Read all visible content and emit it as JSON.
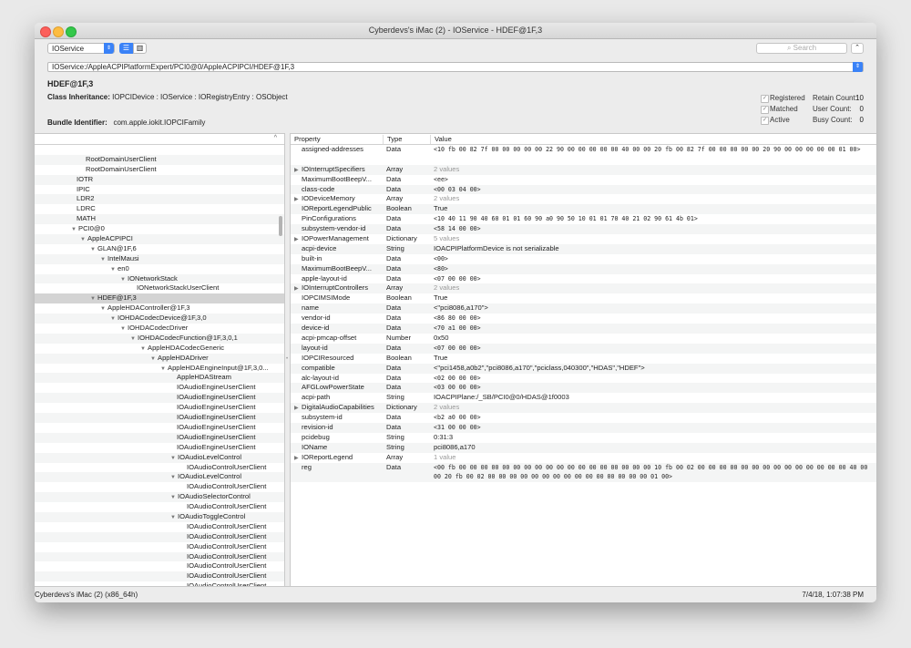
{
  "window": {
    "title": "Cyberdevs's iMac (2) - IOService - HDEF@1F,3"
  },
  "toolbar": {
    "plane": "IOService",
    "search_placeholder": "Search"
  },
  "path": "IOService:/AppleACPIPlatformExpert/PCI0@0/AppleACPIPCI/HDEF@1F,3",
  "info": {
    "entry_name": "HDEF@1F,3",
    "class_inheritance_label": "Class Inheritance:",
    "class_inheritance": "IOPCIDevice : IOService : IORegistryEntry : OSObject",
    "bundle_label": "Bundle Identifier:",
    "bundle_id": "com.apple.iokit.IOPCIFamily",
    "flags": [
      {
        "label": "Registered",
        "count_label": "Retain Count:",
        "count": "10"
      },
      {
        "label": "Matched",
        "count_label": "User Count:",
        "count": "0"
      },
      {
        "label": "Active",
        "count_label": "Busy Count:",
        "count": "0"
      }
    ]
  },
  "tree": [
    {
      "indent": 0,
      "label": "",
      "disclosure": ""
    },
    {
      "indent": 56,
      "label": "RootDomainUserClient",
      "disclosure": ""
    },
    {
      "indent": 56,
      "label": "RootDomainUserClient",
      "disclosure": ""
    },
    {
      "indent": 46,
      "label": "IOTR",
      "disclosure": ""
    },
    {
      "indent": 46,
      "label": "IPIC",
      "disclosure": ""
    },
    {
      "indent": 46,
      "label": "LDR2",
      "disclosure": ""
    },
    {
      "indent": 46,
      "label": "LDRC",
      "disclosure": ""
    },
    {
      "indent": 46,
      "label": "MATH",
      "disclosure": ""
    },
    {
      "indent": 40,
      "label": "PCI0@0",
      "disclosure": "▼"
    },
    {
      "indent": 50,
      "label": "AppleACPIPCI",
      "disclosure": "▼"
    },
    {
      "indent": 61,
      "label": "GLAN@1F,6",
      "disclosure": "▼"
    },
    {
      "indent": 72,
      "label": "IntelMausi",
      "disclosure": "▼"
    },
    {
      "indent": 83,
      "label": "en0",
      "disclosure": "▼"
    },
    {
      "indent": 94,
      "label": "IONetworkStack",
      "disclosure": "▼"
    },
    {
      "indent": 112,
      "label": "IONetworkStackUserClient",
      "disclosure": ""
    },
    {
      "indent": 61,
      "label": "HDEF@1F,3",
      "disclosure": "▼"
    },
    {
      "indent": 72,
      "label": "AppleHDAController@1F,3",
      "disclosure": "▼"
    },
    {
      "indent": 83,
      "label": "IOHDACodecDevice@1F,3,0",
      "disclosure": "▼"
    },
    {
      "indent": 94,
      "label": "IOHDACodecDriver",
      "disclosure": "▼"
    },
    {
      "indent": 105,
      "label": "IOHDACodecFunction@1F,3,0,1",
      "disclosure": "▼"
    },
    {
      "indent": 116,
      "label": "AppleHDACodecGeneric",
      "disclosure": "▼"
    },
    {
      "indent": 127,
      "label": "AppleHDADriver",
      "disclosure": "▼"
    },
    {
      "indent": 138,
      "label": "AppleHDAEngineInput@1F,3,0...",
      "disclosure": "▼"
    },
    {
      "indent": 156,
      "label": "AppleHDAStream",
      "disclosure": ""
    },
    {
      "indent": 156,
      "label": "IOAudioEngineUserClient",
      "disclosure": ""
    },
    {
      "indent": 156,
      "label": "IOAudioEngineUserClient",
      "disclosure": ""
    },
    {
      "indent": 156,
      "label": "IOAudioEngineUserClient",
      "disclosure": ""
    },
    {
      "indent": 156,
      "label": "IOAudioEngineUserClient",
      "disclosure": ""
    },
    {
      "indent": 156,
      "label": "IOAudioEngineUserClient",
      "disclosure": ""
    },
    {
      "indent": 156,
      "label": "IOAudioEngineUserClient",
      "disclosure": ""
    },
    {
      "indent": 156,
      "label": "IOAudioEngineUserClient",
      "disclosure": ""
    },
    {
      "indent": 149,
      "label": "IOAudioLevelControl",
      "disclosure": "▼"
    },
    {
      "indent": 167,
      "label": "IOAudioControlUserClient",
      "disclosure": ""
    },
    {
      "indent": 149,
      "label": "IOAudioLevelControl",
      "disclosure": "▼"
    },
    {
      "indent": 167,
      "label": "IOAudioControlUserClient",
      "disclosure": ""
    },
    {
      "indent": 149,
      "label": "IOAudioSelectorControl",
      "disclosure": "▼"
    },
    {
      "indent": 167,
      "label": "IOAudioControlUserClient",
      "disclosure": ""
    },
    {
      "indent": 149,
      "label": "IOAudioToggleControl",
      "disclosure": "▼"
    },
    {
      "indent": 167,
      "label": "IOAudioControlUserClient",
      "disclosure": ""
    },
    {
      "indent": 167,
      "label": "IOAudioControlUserClient",
      "disclosure": ""
    },
    {
      "indent": 167,
      "label": "IOAudioControlUserClient",
      "disclosure": ""
    },
    {
      "indent": 167,
      "label": "IOAudioControlUserClient",
      "disclosure": ""
    },
    {
      "indent": 167,
      "label": "IOAudioControlUserClient",
      "disclosure": ""
    },
    {
      "indent": 167,
      "label": "IOAudioControlUserClient",
      "disclosure": ""
    },
    {
      "indent": 167,
      "label": "IOAudioControlUserClient",
      "disclosure": ""
    }
  ],
  "tree_selected_index": 15,
  "table": {
    "headers": [
      "Property",
      "Type",
      "Value"
    ],
    "rows": [
      {
        "prop": "assigned-addresses",
        "type": "Data",
        "value": "<10 fb 00 82 7f 00 00 00 00 00 22 90 00 00 00 00 00 40 00 00 20 fb 00 82 7f 00 00 00 00 00 20 90 00 00 00 00 00 01 00>",
        "mono": true,
        "tall": true
      },
      {
        "prop": "IOInterruptSpecifiers",
        "type": "Array",
        "value": "2 values",
        "expand": true,
        "gray": true
      },
      {
        "prop": "MaximumBootBeepV...",
        "type": "Data",
        "value": "<ee>",
        "mono": true
      },
      {
        "prop": "class-code",
        "type": "Data",
        "value": "<00 03 04 00>",
        "mono": true
      },
      {
        "prop": "IODeviceMemory",
        "type": "Array",
        "value": "2 values",
        "expand": true,
        "gray": true
      },
      {
        "prop": "IOReportLegendPublic",
        "type": "Boolean",
        "value": "True"
      },
      {
        "prop": "PinConfigurations",
        "type": "Data",
        "value": "<10 40 11 90 40 60 01 01 60 90 a0 90 50 10 01 01 70 40 21 02 90 61 4b 01>",
        "mono": true
      },
      {
        "prop": "subsystem-vendor-id",
        "type": "Data",
        "value": "<58 14 00 00>",
        "mono": true
      },
      {
        "prop": "IOPowerManagement",
        "type": "Dictionary",
        "value": "5 values",
        "expand": true,
        "gray": true
      },
      {
        "prop": "acpi-device",
        "type": "String",
        "value": "IOACPIPlatformDevice is not serializable"
      },
      {
        "prop": "built-in",
        "type": "Data",
        "value": "<00>",
        "mono": true
      },
      {
        "prop": "MaximumBootBeepV...",
        "type": "Data",
        "value": "<80>",
        "mono": true
      },
      {
        "prop": "apple-layout-id",
        "type": "Data",
        "value": "<07 00 00 00>",
        "mono": true
      },
      {
        "prop": "IOInterruptControllers",
        "type": "Array",
        "value": "2 values",
        "expand": true,
        "gray": true
      },
      {
        "prop": "IOPCIMSIMode",
        "type": "Boolean",
        "value": "True"
      },
      {
        "prop": "name",
        "type": "Data",
        "value": "<\"pci8086,a170\">"
      },
      {
        "prop": "vendor-id",
        "type": "Data",
        "value": "<86 80 00 00>",
        "mono": true
      },
      {
        "prop": "device-id",
        "type": "Data",
        "value": "<70 a1 00 00>",
        "mono": true
      },
      {
        "prop": "acpi-pmcap-offset",
        "type": "Number",
        "value": "0x50"
      },
      {
        "prop": "layout-id",
        "type": "Data",
        "value": "<07 00 00 00>",
        "mono": true
      },
      {
        "prop": "IOPCIResourced",
        "type": "Boolean",
        "value": "True"
      },
      {
        "prop": "compatible",
        "type": "Data",
        "value": "<\"pci1458,a0b2\",\"pci8086,a170\",\"pciclass,040300\",\"HDAS\",\"HDEF\">"
      },
      {
        "prop": "alc-layout-id",
        "type": "Data",
        "value": "<02 00 00 00>",
        "mono": true
      },
      {
        "prop": "AFGLowPowerState",
        "type": "Data",
        "value": "<03 00 00 00>",
        "mono": true
      },
      {
        "prop": "acpi-path",
        "type": "String",
        "value": "IOACPIPlane:/_SB/PCI0@0/HDAS@1f0003"
      },
      {
        "prop": "DigitalAudioCapabilities",
        "type": "Dictionary",
        "value": "2 values",
        "expand": true,
        "gray": true
      },
      {
        "prop": "subsystem-id",
        "type": "Data",
        "value": "<b2 a0 00 00>",
        "mono": true
      },
      {
        "prop": "revision-id",
        "type": "Data",
        "value": "<31 00 00 00>",
        "mono": true
      },
      {
        "prop": "pcidebug",
        "type": "String",
        "value": "0:31:3"
      },
      {
        "prop": "IOName",
        "type": "String",
        "value": "pci8086,a170"
      },
      {
        "prop": "IOReportLegend",
        "type": "Array",
        "value": "1 value",
        "expand": true,
        "gray": true
      },
      {
        "prop": "reg",
        "type": "Data",
        "value": "<00 fb 00 00 00 00 00 00 00 00 00 00 00 00 00 00 00 00 00 00 10 fb 00 02 00 00 00 00 00 00 00 00 00 00 00 00 00 00 40 00 00 20 fb 00 02 00 00 00 00 00 00 00 00 00 00 00 00 00 00 00 01 00>",
        "mono": true,
        "tall": true
      }
    ]
  },
  "status": {
    "left": "Cyberdevs's iMac (2) (x86_64h)",
    "right": "7/4/18, 1:07:38 PM"
  }
}
